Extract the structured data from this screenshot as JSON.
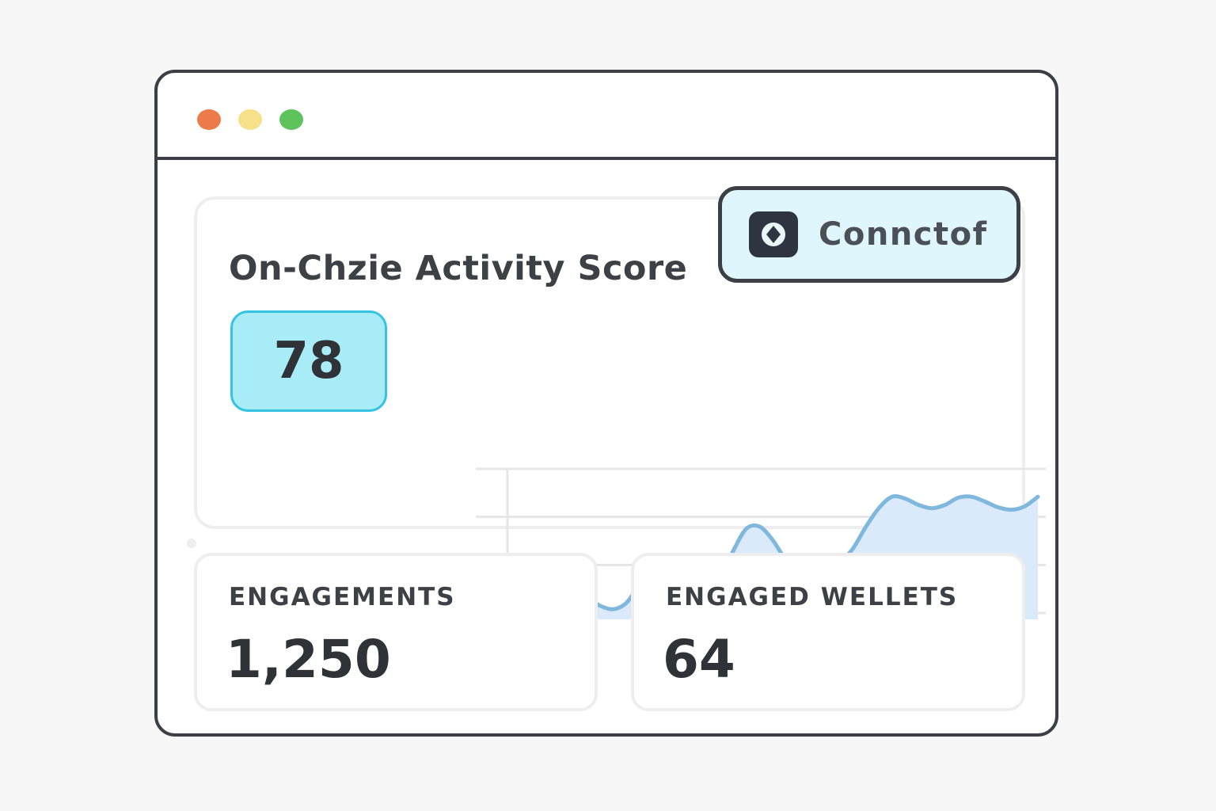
{
  "window": {
    "controls": [
      {
        "name": "close",
        "color": "#ec7a4a"
      },
      {
        "name": "minimize",
        "color": "#f6e08a"
      },
      {
        "name": "maximize",
        "color": "#5fc35d"
      }
    ]
  },
  "score_card": {
    "title": "On-Chzie Activity Score",
    "score": "78",
    "badge_color": "#a8ecf7"
  },
  "connect_button": {
    "label": "Connctof",
    "icon": "wallet-icon"
  },
  "chart_data": {
    "type": "area",
    "title": "",
    "xlabel": "",
    "ylabel": "",
    "y_range": [
      0,
      3
    ],
    "grid": true,
    "x": [
      0,
      1,
      2,
      3,
      4,
      5,
      6,
      7,
      8,
      9,
      10,
      11,
      12,
      13,
      14,
      15,
      16,
      17,
      18,
      19,
      20,
      21,
      22,
      23,
      24,
      25,
      26,
      27,
      28,
      29,
      30,
      31,
      32,
      33,
      34,
      35,
      36,
      37,
      38,
      39,
      40
    ],
    "series": [
      {
        "values": [
          0.0,
          0.2,
          0.42,
          0.58,
          0.6,
          0.5,
          0.32,
          0.15,
          0.08,
          0.22,
          0.62,
          0.95,
          1.05,
          0.92,
          0.6,
          0.45,
          0.72,
          1.28,
          1.75,
          1.8,
          1.52,
          1.1,
          0.85,
          0.8,
          0.9,
          1.05,
          1.32,
          1.78,
          2.18,
          2.42,
          2.38,
          2.25,
          2.18,
          2.25,
          2.4,
          2.42,
          2.32,
          2.2,
          2.15,
          2.22,
          2.42
        ],
        "color": "#7fb8dc",
        "fill": "#dbeafa"
      }
    ]
  },
  "stats": [
    {
      "label": "ENGAGEMENTS",
      "value": "1,250"
    },
    {
      "label": "ENGAGED WELLETS",
      "value": "64"
    }
  ]
}
